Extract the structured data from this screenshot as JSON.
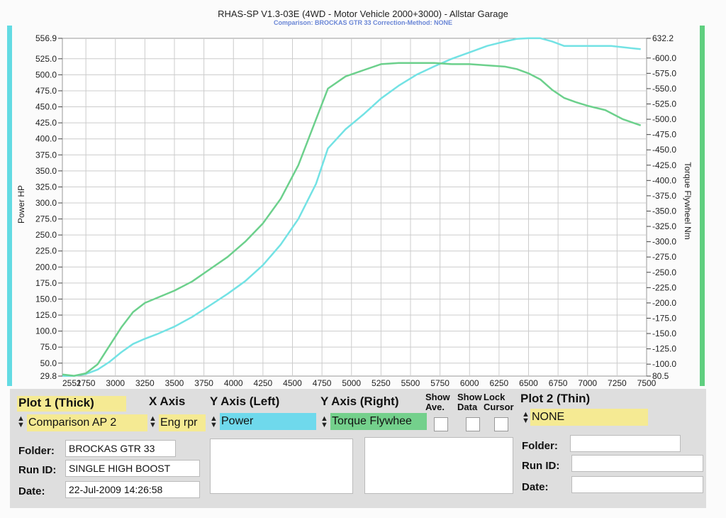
{
  "title": "RHAS-SP V1.3-03E  (4WD - Motor Vehicle 2000+3000) - Allstar Garage",
  "subtitle": "Comparison: BROCKAS GTR 33   Correction-Method: NONE",
  "colors": {
    "power": "#73e2e4",
    "torque": "#6cd08c",
    "plot1_bg": "#f5ea93",
    "power_sel": "#6fd9ec",
    "torque_sel": "#74d08c",
    "grid": "#cccccc"
  },
  "chart_data": {
    "type": "line",
    "title": "RHAS-SP V1.3-03E  (4WD - Motor Vehicle 2000+3000) - Allstar Garage",
    "subtitle": "Comparison: BROCKAS GTR 33   Correction-Method: NONE",
    "ylabel_left": "Power HP",
    "ylabel_right": "Torque Flywheel Nm",
    "xlim": [
      2551,
      7500
    ],
    "ylim_left": [
      29.8,
      556.9
    ],
    "ylim_right": [
      80.5,
      632.2
    ],
    "x_tick_labels": [
      "2551",
      "2750",
      "3000",
      "3250",
      "3500",
      "3750",
      "4000",
      "4250",
      "4500",
      "4750",
      "5000",
      "5250",
      "5500",
      "5750",
      "6000",
      "6250",
      "6500",
      "6750",
      "7000",
      "7250",
      "7500"
    ],
    "x_ticks": [
      2551,
      2750,
      3000,
      3250,
      3500,
      3750,
      4000,
      4250,
      4500,
      4750,
      5000,
      5250,
      5500,
      5750,
      6000,
      6250,
      6500,
      6750,
      7000,
      7250,
      7500
    ],
    "y_left_tick_labels": [
      "556.9",
      "525.0",
      "500.0",
      "475.0",
      "450.0",
      "425.0",
      "400.0",
      "375.0",
      "350.0",
      "325.0",
      "300.0",
      "275.0",
      "250.0",
      "225.0",
      "200.0",
      "175.0",
      "150.0",
      "125.0",
      "100.0",
      "75.0",
      "50.0",
      "29.8"
    ],
    "y_left_ticks": [
      556.9,
      525,
      500,
      475,
      450,
      425,
      400,
      375,
      350,
      325,
      300,
      275,
      250,
      225,
      200,
      175,
      150,
      125,
      100,
      75,
      50,
      29.8
    ],
    "y_right_tick_labels": [
      "632.2",
      "600.0",
      "575.0",
      "550.0",
      "525.0",
      "500.0",
      "475.0",
      "450.0",
      "425.0",
      "400.0",
      "375.0",
      "350.0",
      "325.0",
      "300.0",
      "275.0",
      "250.0",
      "225.0",
      "200.0",
      "175.0",
      "150.0",
      "125.0",
      "100.0",
      "80.5"
    ],
    "y_right_ticks": [
      632.2,
      600,
      575,
      550,
      525,
      500,
      475,
      450,
      425,
      400,
      375,
      350,
      325,
      300,
      275,
      250,
      225,
      200,
      175,
      150,
      125,
      100,
      80.5
    ],
    "series": [
      {
        "name": "Power",
        "axis": "left",
        "color": "#73e2e4",
        "x": [
          2551,
          2650,
          2750,
          2850,
          2950,
          3050,
          3150,
          3250,
          3350,
          3500,
          3650,
          3800,
          3950,
          4100,
          4250,
          4400,
          4550,
          4700,
          4800,
          4950,
          5100,
          5250,
          5400,
          5550,
          5700,
          5850,
          6000,
          6150,
          6300,
          6400,
          6500,
          6600,
          6700,
          6800,
          6900,
          7000,
          7200,
          7350,
          7450
        ],
        "y": [
          30,
          30,
          33,
          40,
          52,
          67,
          80,
          88,
          95,
          107,
          122,
          140,
          158,
          178,
          203,
          235,
          275,
          330,
          385,
          415,
          438,
          463,
          483,
          500,
          513,
          525,
          535,
          545,
          552,
          556,
          557,
          557,
          552,
          545,
          545,
          545,
          545,
          542,
          540
        ]
      },
      {
        "name": "Torque Flywheel",
        "axis": "right",
        "color": "#6cd08c",
        "x": [
          2551,
          2650,
          2750,
          2850,
          2950,
          3050,
          3150,
          3250,
          3350,
          3500,
          3650,
          3800,
          3950,
          4100,
          4250,
          4400,
          4550,
          4700,
          4800,
          4950,
          5100,
          5250,
          5400,
          5550,
          5700,
          5850,
          6000,
          6150,
          6300,
          6400,
          6500,
          6600,
          6700,
          6800,
          6900,
          7000,
          7150,
          7300,
          7450
        ],
        "y": [
          83,
          81,
          85,
          100,
          130,
          160,
          185,
          200,
          208,
          220,
          235,
          255,
          275,
          300,
          330,
          370,
          425,
          500,
          550,
          570,
          580,
          590,
          592,
          592,
          592,
          590,
          590,
          588,
          586,
          582,
          575,
          565,
          548,
          535,
          528,
          522,
          515,
          500,
          490
        ]
      }
    ]
  },
  "panel": {
    "plot1_label": "Plot 1 (Thick)",
    "plot1_value": "Comparison AP 2",
    "xaxis_label": "X Axis",
    "xaxis_value": "Eng rpr",
    "yleft_label": "Y Axis (Left)",
    "yleft_value": "Power",
    "yright_label": "Y Axis (Right)",
    "yright_value": "Torque Flywhee",
    "show_ave_label1": "Show",
    "show_ave_label2": "Ave.",
    "show_data_label1": "Show",
    "show_data_label2": "Data",
    "lock_cursor_label1": "Lock",
    "lock_cursor_label2": "Cursor",
    "plot2_label": "Plot 2 (Thin)",
    "plot2_value": "NONE",
    "folder_label": "Folder:",
    "folder_value": "BROCKAS GTR 33",
    "runid_label": "Run ID:",
    "runid_value": "SINGLE HIGH BOOST",
    "date_label": "Date:",
    "date_value": "22-Jul-2009  14:26:58",
    "folder2_label": "Folder:",
    "folder2_value": "",
    "runid2_label": "Run ID:",
    "runid2_value": "",
    "date2_label": "Date:",
    "date2_value": ""
  }
}
